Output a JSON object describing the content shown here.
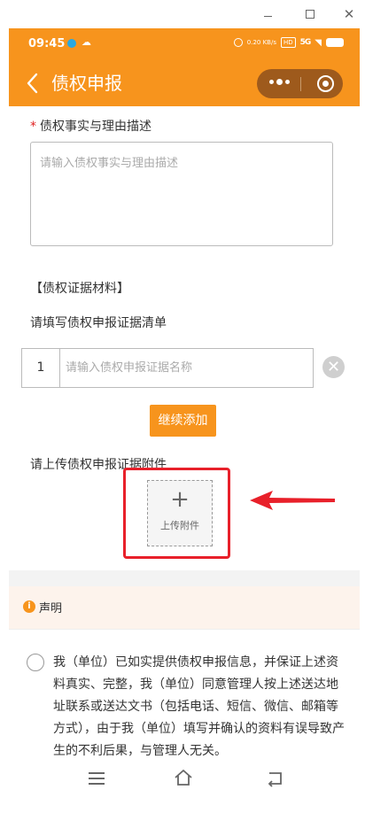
{
  "window": {
    "minimize_icon": "minimize-icon",
    "maximize_icon": "maximize-icon",
    "close_glyph": "✕"
  },
  "status_bar": {
    "time": "09:45",
    "cloud_glyph": "☁",
    "net_speed": "0.20 KB/s",
    "hd": "HD",
    "signal": "5G",
    "wifi_glyph": "◥"
  },
  "nav": {
    "title": "债权申报",
    "back_icon": "chevron-left-icon",
    "more_icon": "more-dots-icon",
    "target_icon": "target-icon"
  },
  "form": {
    "required_mark": "*",
    "facts_label": "债权事实与理由描述",
    "facts_placeholder": "请输入债权事实与理由描述",
    "evidence_section_title": "【债权证据材料】",
    "evidence_list_label": "请填写债权申报证据清单",
    "evidence_rows": [
      {
        "index": "1",
        "placeholder": "请输入债权申报证据名称"
      }
    ],
    "delete_glyph": "✕",
    "add_button": "继续添加",
    "upload_label": "请上传债权申报证据附件",
    "upload_plus": "+",
    "upload_text": "上传附件"
  },
  "notice": {
    "icon_glyph": "i",
    "title": "声明",
    "statement": "我（单位）已如实提供债权申报信息，并保证上述资料真实、完整，我（单位）同意管理人按上述送达地址联系或送达文书（包括电话、短信、微信、邮箱等方式），由于我（单位）填写并确认的资料有误导致产生的不利后果，与管理人无关。"
  },
  "colors": {
    "brand": "#f7941d",
    "highlight": "#e8202a"
  }
}
